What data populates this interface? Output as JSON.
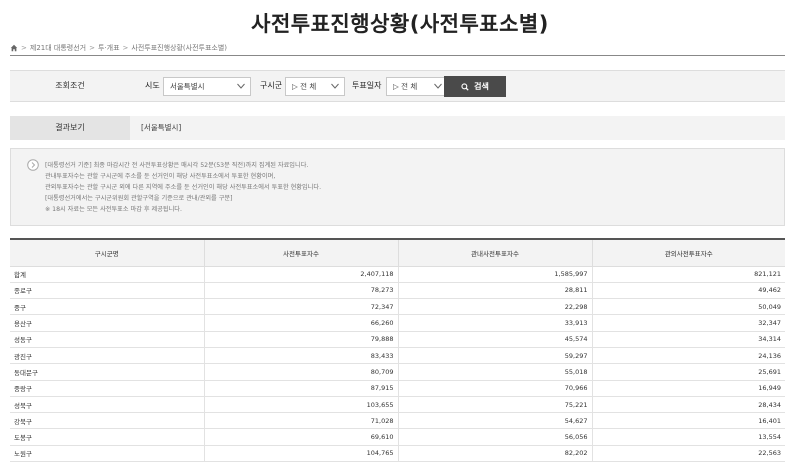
{
  "page": {
    "title": "사전투표진행상황(사전투표소별)"
  },
  "breadcrumb": [
    "제21대 대통령선거",
    "투·개표",
    "사전투표진행상황(사전투표소별)"
  ],
  "search": {
    "heading": "조회조건",
    "sido_label": "시도",
    "sido_value": "서울특별시",
    "sigungu_label": "구시군",
    "sigungu_value": "▷ 전 체",
    "date_label": "투표일자",
    "date_value": "▷ 전 체",
    "button_label": "검색"
  },
  "result": {
    "label": "결과보기",
    "value": "[서울특별시]"
  },
  "notice": {
    "lines": [
      "[대통령선거 기준] 최종 마감시간 전 사전투표상황은 매시각 52분(53분 직전)까지 집계된 자료입니다.",
      "관내투표자수는 관할 구시군에 주소를 둔 선거인이 해당 사전투표소에서 투표한 현황이며,",
      "관외투표자수는 관할 구시군 외에 다른 지역에 주소를 둔 선거인이 해당 사전투표소에서 투표한 현황입니다.",
      "[대통령선거에서는 구시군위원회 관할구역을 기준으로 관내/관외를 구분]",
      "※ 18시 자료는 모든 사전투표소 마감 후 제공됩니다."
    ]
  },
  "table": {
    "headers": [
      "구시군명",
      "사전투표자수",
      "관내사전투표자수",
      "관외사전투표자수"
    ],
    "rows": [
      [
        "합계",
        "2,407,118",
        "1,585,997",
        "821,121"
      ],
      [
        "종로구",
        "78,273",
        "28,811",
        "49,462"
      ],
      [
        "중구",
        "72,347",
        "22,298",
        "50,049"
      ],
      [
        "용산구",
        "66,260",
        "33,913",
        "32,347"
      ],
      [
        "성동구",
        "79,888",
        "45,574",
        "34,314"
      ],
      [
        "광진구",
        "83,433",
        "59,297",
        "24,136"
      ],
      [
        "동대문구",
        "80,709",
        "55,018",
        "25,691"
      ],
      [
        "중랑구",
        "87,915",
        "70,966",
        "16,949"
      ],
      [
        "성북구",
        "103,655",
        "75,221",
        "28,434"
      ],
      [
        "강북구",
        "71,028",
        "54,627",
        "16,401"
      ],
      [
        "도봉구",
        "69,610",
        "56,056",
        "13,554"
      ],
      [
        "노원구",
        "104,765",
        "82,202",
        "22,563"
      ]
    ]
  }
}
